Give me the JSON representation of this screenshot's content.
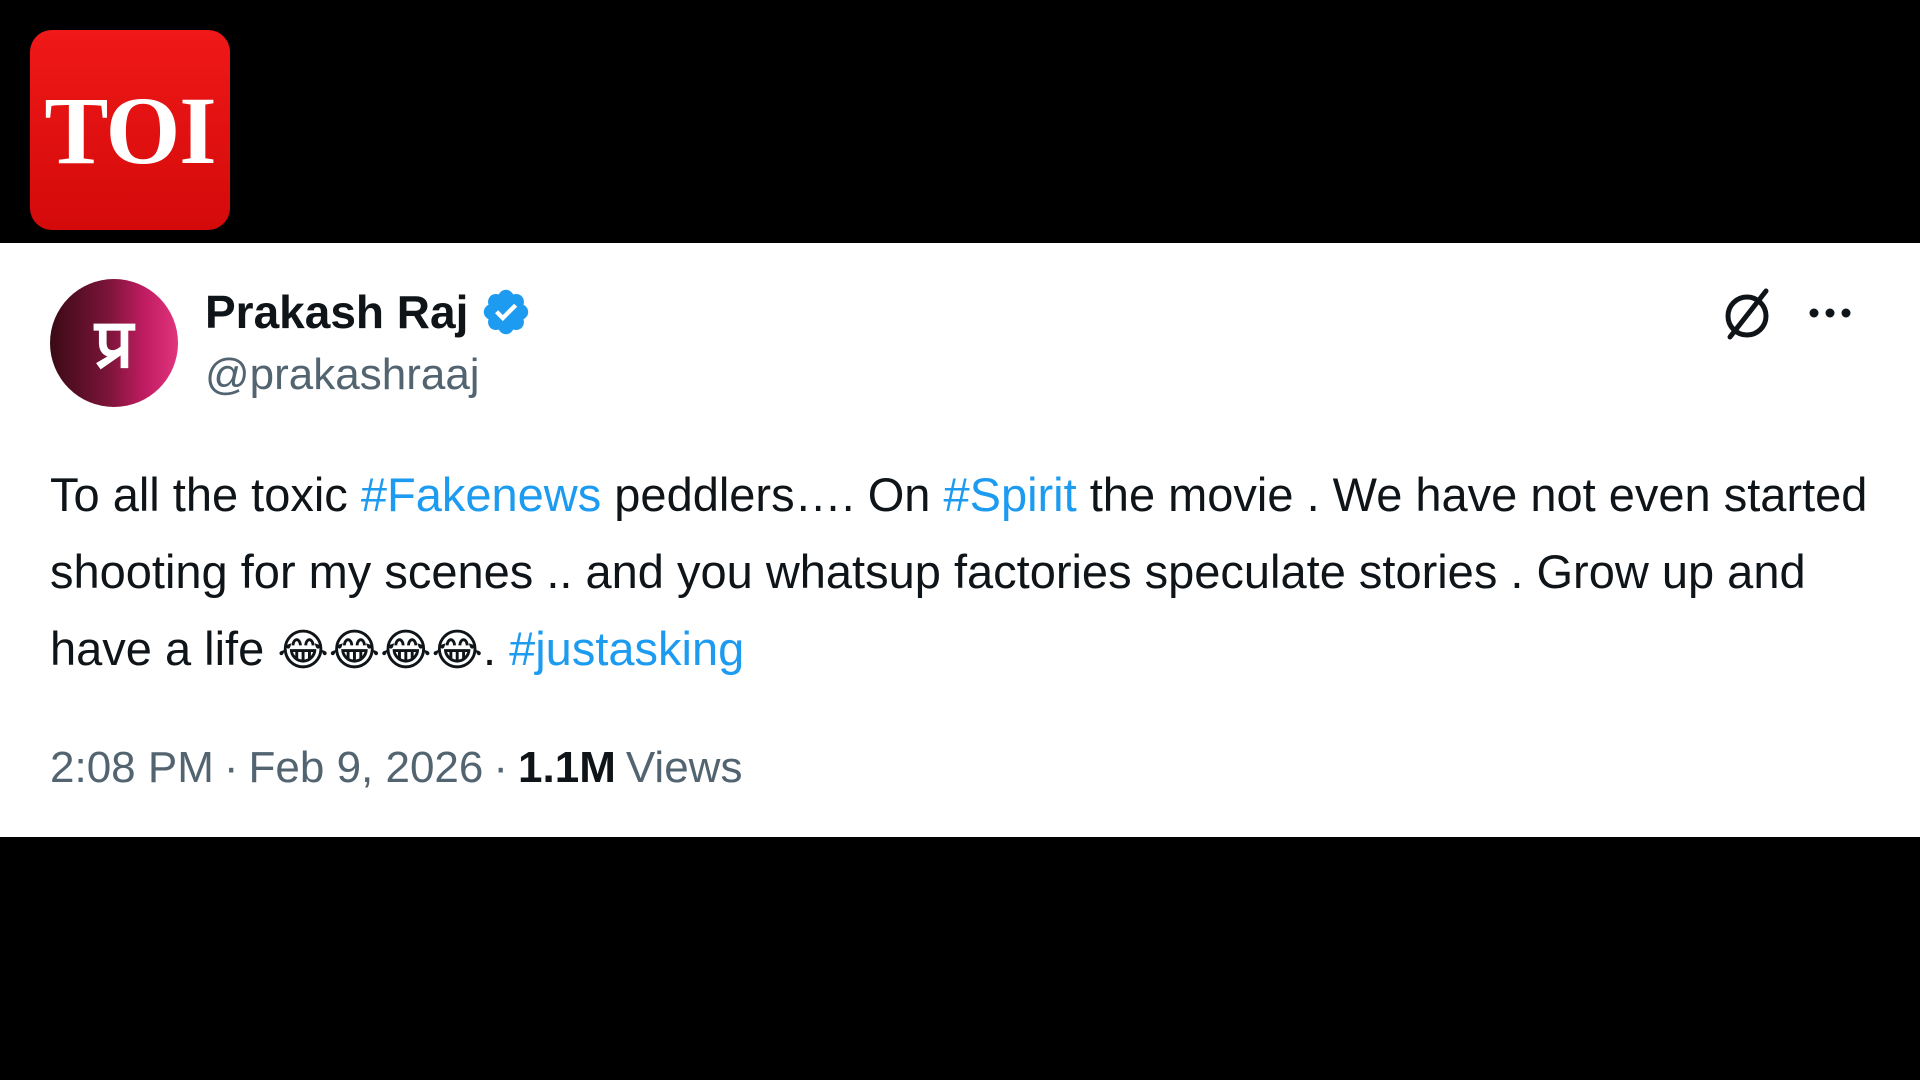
{
  "logo": {
    "text": "TOI",
    "color": "#e51212"
  },
  "tweet": {
    "author": {
      "display_name": "Prakash Raj",
      "handle": "@prakashraaj",
      "avatar_text": "प्र",
      "verified": true
    },
    "icons": {
      "grok": "grok-icon",
      "more": "more-icon",
      "verified": "verified-badge-icon"
    },
    "text_segments": [
      {
        "text": "To all the toxic ",
        "type": "text"
      },
      {
        "text": "#Fakenews",
        "type": "hashtag"
      },
      {
        "text": " peddlers…. On ",
        "type": "text"
      },
      {
        "text": "#Spirit",
        "type": "hashtag"
      },
      {
        "text": "  the movie . We have not even started shooting for my scenes .. and you whatsup factories speculate stories . Grow up and have a life ",
        "type": "text"
      },
      {
        "text": "😂😂😂😂",
        "type": "emoji"
      },
      {
        "text": ". ",
        "type": "text"
      },
      {
        "text": "#justasking",
        "type": "hashtag"
      }
    ],
    "time": "2:08 PM",
    "separator": "·",
    "date": "Feb 9, 2026",
    "views_count": "1.1M",
    "views_label": "Views"
  },
  "colors": {
    "hashtag": "#1d9bf0",
    "text": "#0f1419",
    "secondary": "#536471",
    "background": "#000000",
    "card": "#ffffff"
  }
}
